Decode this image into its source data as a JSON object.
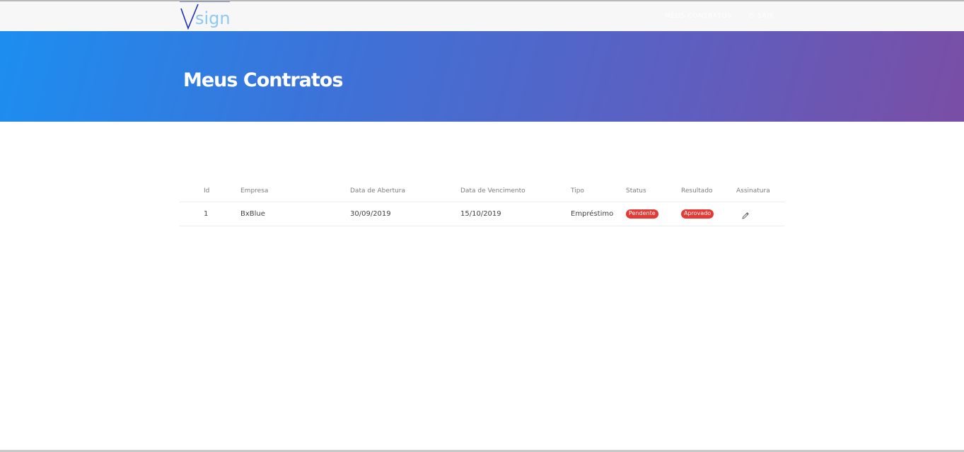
{
  "brand": {
    "logo_text": "sign",
    "logo_mark": "V"
  },
  "nav": {
    "items": [
      {
        "label": "MEUS CONTRATOS",
        "icon": ""
      },
      {
        "label": "SAIR",
        "icon": "power-icon"
      }
    ]
  },
  "hero": {
    "title": "Meus Contratos"
  },
  "table": {
    "headers": [
      "Id",
      "Empresa",
      "Data de Abertura",
      "Data de Vencimento",
      "Tipo",
      "Status",
      "Resultado",
      "Assinatura"
    ],
    "rows": [
      {
        "id": "1",
        "empresa": "BxBlue",
        "abertura": "30/09/2019",
        "vencimento": "15/10/2019",
        "tipo": "Empréstimo",
        "status": "Pendente",
        "resultado": "Aprovado",
        "assinatura_icon": "pencil-icon"
      }
    ]
  },
  "colors": {
    "badge": "#e53935",
    "hero_gradient_start": "#1c8ef0",
    "hero_gradient_end": "#7a4ea5",
    "logo_v": "#1c2fb5",
    "logo_text": "#8ec9f2"
  }
}
